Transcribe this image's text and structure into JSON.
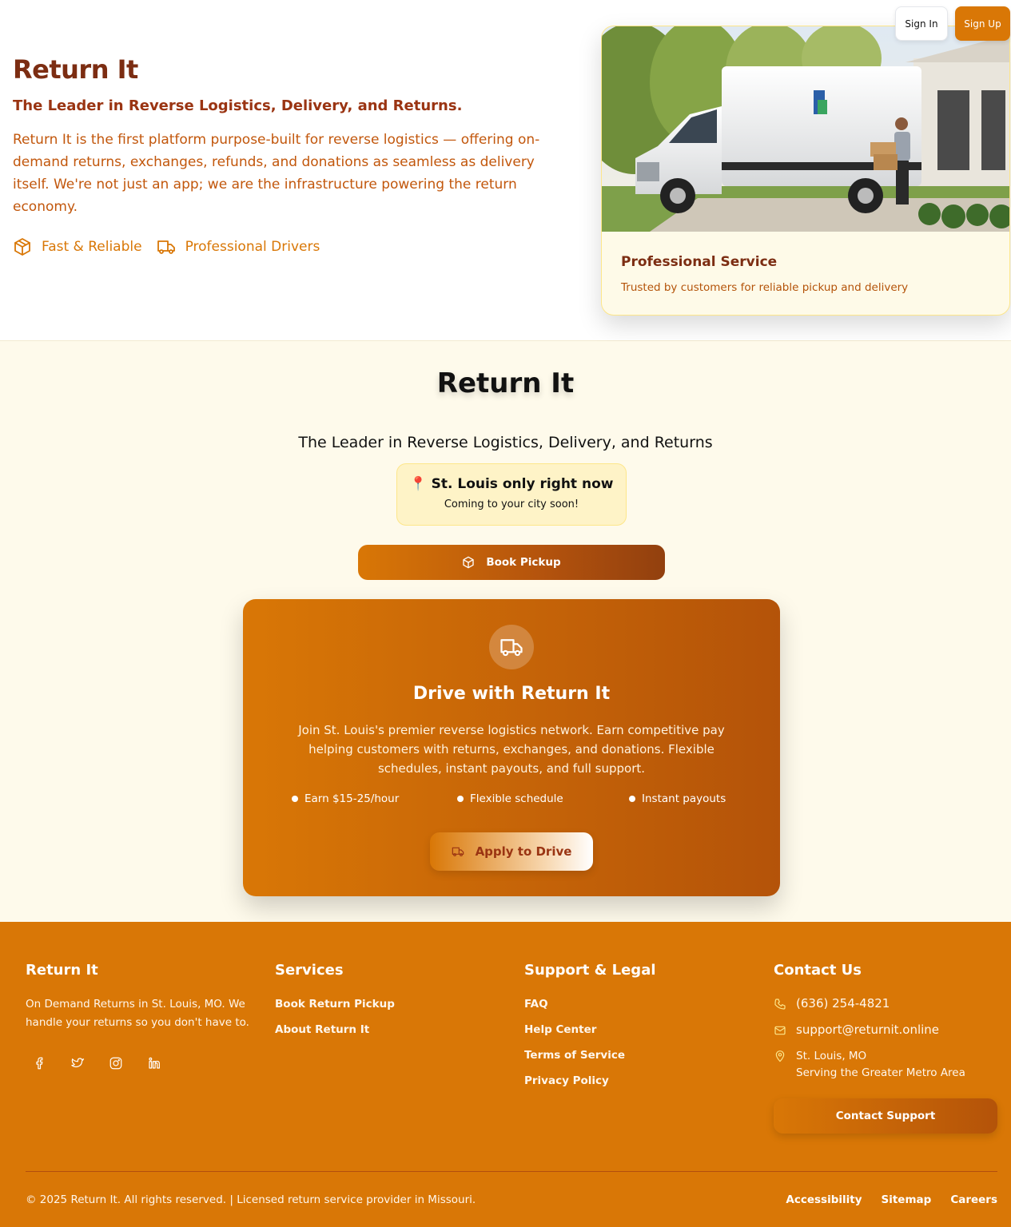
{
  "auth": {
    "signin": "Sign In",
    "signup": "Sign Up"
  },
  "hero": {
    "title": "Return It",
    "tagline": "The Leader in Reverse Logistics, Delivery, and Returns.",
    "description": "Return It is the first platform purpose-built for reverse logistics — offering on-demand returns, exchanges, refunds, and donations as seamless as delivery itself. We're not just an app; we are the infrastructure powering the return economy.",
    "features": [
      {
        "icon": "package-icon",
        "label": "Fast & Reliable"
      },
      {
        "icon": "truck-icon",
        "label": "Professional Drivers"
      }
    ],
    "card": {
      "title": "Professional Service",
      "subtitle": "Trusted by customers for reliable pickup and delivery"
    }
  },
  "main": {
    "title": "Return It",
    "tagline": "The Leader in Reverse Logistics, Delivery, and Returns",
    "location": {
      "pin": "📍",
      "text": "St. Louis only right now",
      "sub": "Coming to your city soon!"
    },
    "book_button": "Book Pickup",
    "drive": {
      "title": "Drive with Return It",
      "description": "Join St. Louis's premier reverse logistics network. Earn competitive pay helping customers with returns, exchanges, and donations. Flexible schedules, instant payouts, and full support.",
      "points": [
        "Earn $15-25/hour",
        "Flexible schedule",
        "Instant payouts"
      ],
      "apply_button": "Apply to Drive"
    }
  },
  "footer": {
    "brand": {
      "title": "Return It",
      "about": "On Demand Returns in St. Louis, MO. We handle your returns so you don't have to.",
      "socials": [
        "facebook-icon",
        "twitter-icon",
        "instagram-icon",
        "linkedin-icon"
      ]
    },
    "services": {
      "title": "Services",
      "links": [
        "Book Return Pickup",
        "About Return It"
      ]
    },
    "support": {
      "title": "Support & Legal",
      "links": [
        "FAQ",
        "Help Center",
        "Terms of Service",
        "Privacy Policy"
      ]
    },
    "contact": {
      "title": "Contact Us",
      "phone": "(636) 254-4821",
      "email": "support@returnit.online",
      "city": "St. Louis, MO",
      "area": "Serving the Greater Metro Area",
      "button": "Contact Support"
    },
    "copyright": "© 2025 Return It. All rights reserved. | Licensed return service provider in Missouri.",
    "bottom_links": [
      "Accessibility",
      "Sitemap",
      "Careers"
    ]
  },
  "colors": {
    "brand": "#d97706",
    "brand_dark": "#7c2d12",
    "cream": "#fefaeb"
  }
}
